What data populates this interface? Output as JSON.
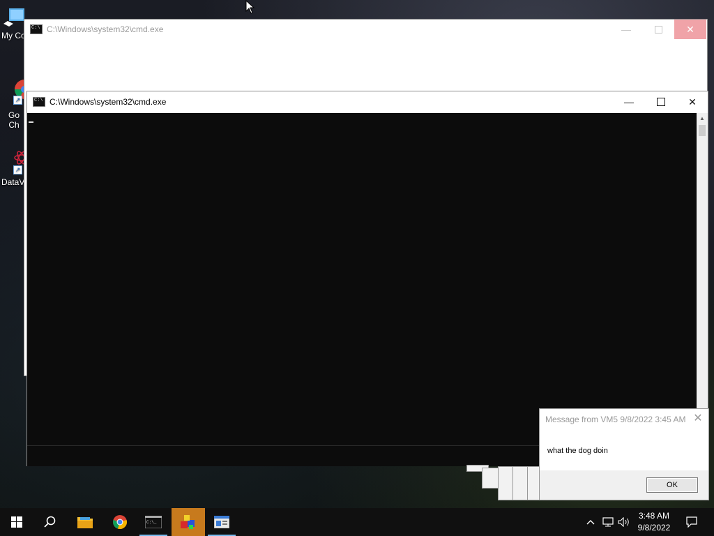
{
  "desktop": {
    "icons": [
      {
        "label": "My Co",
        "icon": "this-pc-icon"
      },
      {
        "label": "Go\nCh",
        "icon": "chrome-icon"
      },
      {
        "label": "DataV",
        "icon": "datav-icon"
      }
    ]
  },
  "back_window": {
    "title": "C:\\Windows\\system32\\cmd.exe"
  },
  "front_window": {
    "title": "C:\\Windows\\system32\\cmd.exe"
  },
  "message_dialog": {
    "title": "Message from VM5 9/8/2022 3:45 AM",
    "body": "what the dog doin",
    "ok_label": "OK"
  },
  "taskbar": {
    "items": [
      {
        "icon": "windows-start-icon"
      },
      {
        "icon": "search-icon"
      },
      {
        "icon": "file-explorer-icon"
      },
      {
        "icon": "chrome-icon"
      },
      {
        "icon": "cmd-icon"
      },
      {
        "icon": "app-blocks-icon"
      },
      {
        "icon": "msg-window-icon"
      }
    ],
    "tray": [
      "chevron-up-icon",
      "network-icon",
      "volume-icon"
    ],
    "clock_time": "3:48 AM",
    "clock_date": "9/8/2022",
    "colors": {
      "active": "#c77a1d",
      "underline": "#76b9ed"
    }
  }
}
